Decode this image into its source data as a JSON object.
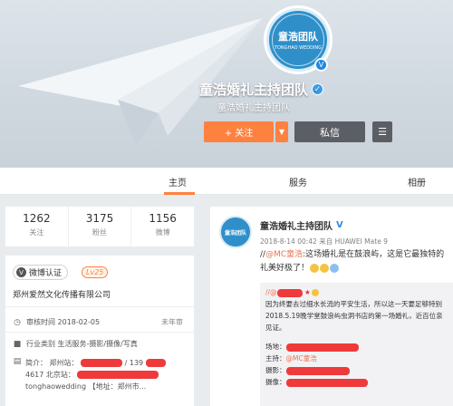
{
  "profile": {
    "avatar_text": "童浩团队",
    "avatar_subtext": "TONGHAO WEDDING",
    "name": "童浩婚礼主持团队",
    "subtitle": "童浩婚礼主持团队",
    "follow_label": "+ 关注",
    "message_label": "私信",
    "menu_icon": "hamburger-icon"
  },
  "tabs": [
    {
      "label": "主页",
      "active": true
    },
    {
      "label": "服务",
      "active": false
    },
    {
      "label": "相册",
      "active": false
    }
  ],
  "stats": [
    {
      "num": "1262",
      "label": "关注"
    },
    {
      "num": "3175",
      "label": "粉丝"
    },
    {
      "num": "1156",
      "label": "微博"
    }
  ],
  "info": {
    "verify_label": "微博认证",
    "level": "Lv25",
    "company": "郑州爱然文化传播有限公司",
    "audit_label": "审核时间 2018-02-05",
    "year_label": "未年审",
    "industry": "行业类别  生活服务-摄影/摄像/写真",
    "bio_label": "简介：",
    "bio_line1_a": "郑州站：",
    "bio_line1_b": "/ 139",
    "bio_line2_a": "4617 北京站：",
    "bio_line3": "tonghaowedding 【地址：郑州市..."
  },
  "post": {
    "avatar_text": "童浩团队",
    "name": "童浩婚礼主持团队",
    "verified_mark": "V",
    "meta": "2018-8-14 00:42 来自 HUAWEI Mate 9",
    "text_line1_prefix": "//",
    "text_mention": "@MC童浩",
    "text_line1_suffix": ":这场婚礼是在鼓浪屿，这是它最独特的",
    "text_line2": "礼美好极了！",
    "repost_lines": [
      "因为终要去过细水长流的平安生活，所以这一天要足够特别",
      "2018.5.19晚学堂鼓浪屿虫洞书店的第一场婚礼，近百位亲",
      "见证。"
    ],
    "venue_label": "场地：",
    "host_label": "主持：",
    "host_value": "@MC童浩",
    "photo_label": "摄影：",
    "video_label": "摄像："
  }
}
